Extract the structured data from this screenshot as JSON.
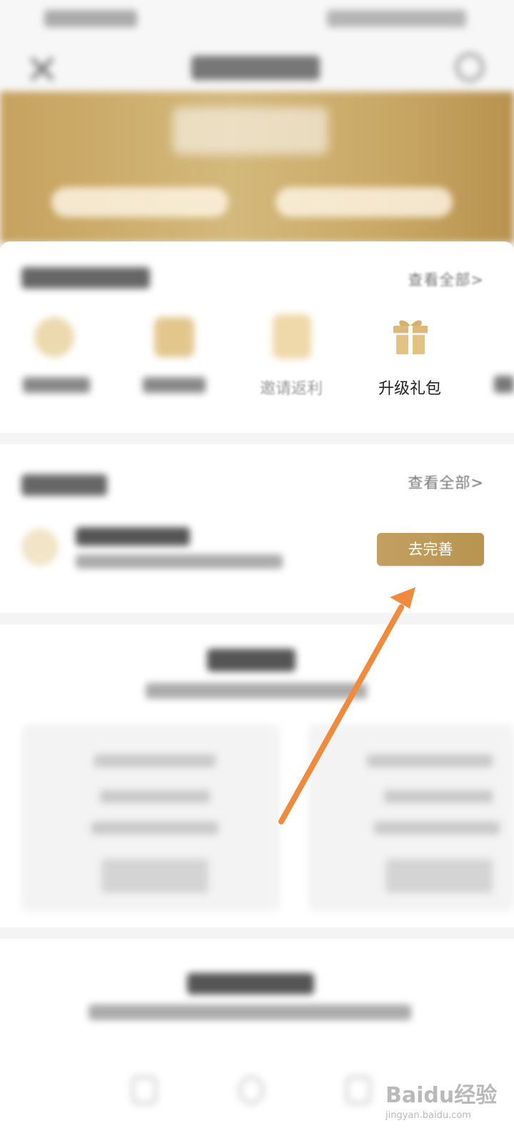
{
  "benefits_section": {
    "view_all": "查看全部>",
    "items": [
      {
        "label": "升级礼包"
      },
      {
        "label": "邀请返利"
      }
    ]
  },
  "tasks_section": {
    "view_all": "查看全部>",
    "complete_button": "去完善"
  },
  "watermark": {
    "brand": "Baidu经验",
    "url": "jingyan.baidu.com"
  },
  "colors": {
    "accent_gold": "#c3a062",
    "arrow": "#f08a3c"
  }
}
